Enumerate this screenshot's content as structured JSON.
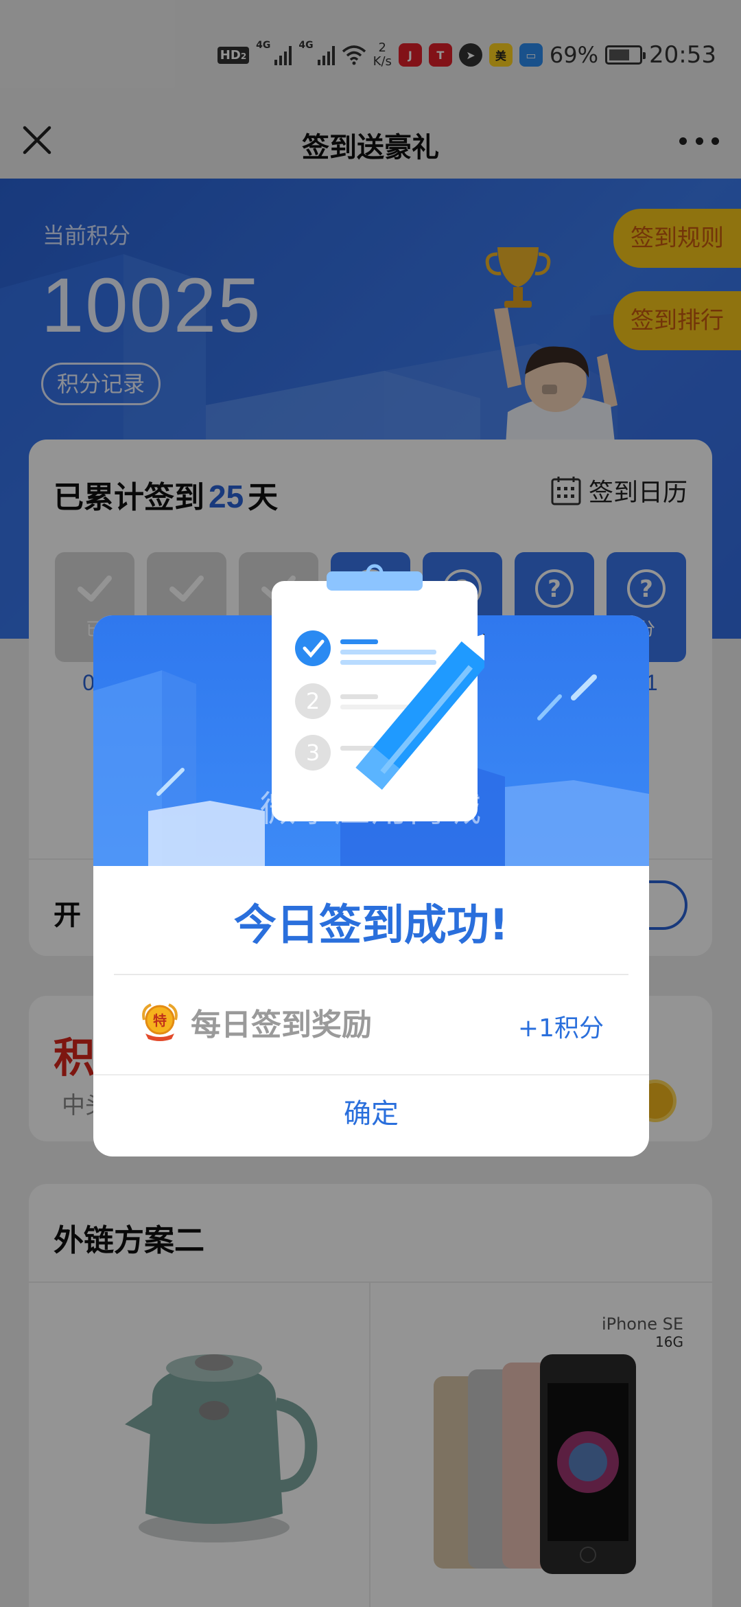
{
  "status_bar": {
    "hd_label": "HD",
    "hd_sub": "2",
    "net_type_1": "4G",
    "net_type_2": "4G",
    "speed_value": "2",
    "speed_unit": "K/s",
    "battery_percent": "69%",
    "battery_level": 0.69,
    "time": "20:53",
    "apps": [
      {
        "name": "jd-app-icon",
        "color": "#e0202a"
      },
      {
        "name": "tmall-app-icon",
        "color": "#e0202a"
      },
      {
        "name": "feather-app-icon",
        "color": "#333333"
      },
      {
        "name": "meituan-app-icon",
        "color": "#ffd21f",
        "text": "美"
      },
      {
        "name": "message-app-icon",
        "color": "#2b8cf0"
      }
    ]
  },
  "title_bar": {
    "title": "签到送豪礼"
  },
  "hero": {
    "label": "当前积分",
    "points": "10025",
    "record_button": "积分记录",
    "rules_button": "签到规则",
    "rank_button": "签到排行"
  },
  "signin_card": {
    "title_prefix": "已累计签到",
    "days": "25",
    "title_suffix": "天",
    "calendar_label": "签到日历",
    "bottom_partial": "开",
    "days_list": [
      {
        "state": "done",
        "label": "已",
        "date": "04"
      },
      {
        "state": "done",
        "label": "",
        "date": ""
      },
      {
        "state": "done",
        "label": "",
        "date": ""
      },
      {
        "state": "todo",
        "label": "",
        "date": ""
      },
      {
        "state": "todo",
        "label": "",
        "date": ""
      },
      {
        "state": "todo",
        "label": "",
        "date": ""
      },
      {
        "state": "todo",
        "label": "分",
        "date": "11"
      }
    ]
  },
  "points_card": {
    "title_partial": "积",
    "sub_partial": "中头"
  },
  "goods_card": {
    "title": "外链方案二",
    "phone_brand": "iPhone SE",
    "phone_capacity": "16G"
  },
  "dialog": {
    "title": "今日签到成功!",
    "reward_label": "每日签到奖励",
    "reward_value": "+1积分",
    "confirm": "确定",
    "watermark": "微擎应用商城",
    "medal_text": "特"
  },
  "colors": {
    "brand_blue": "#2a63d6",
    "accent_yellow": "#f6c61a",
    "red": "#d8261c"
  }
}
